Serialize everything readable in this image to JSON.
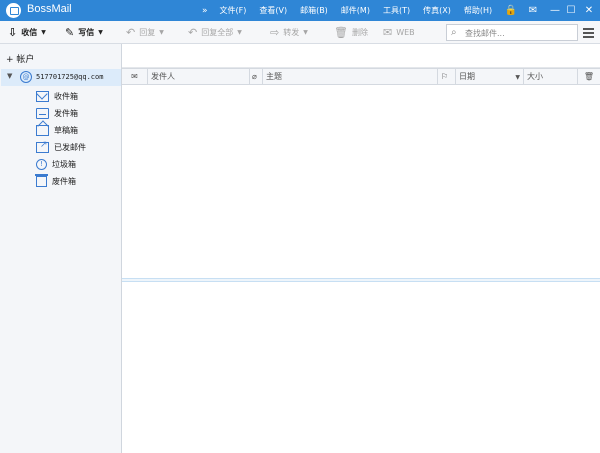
{
  "app": {
    "title": "BossMail"
  },
  "menu": [
    "文件(F)",
    "查看(V)",
    "邮箱(B)",
    "邮件(M)",
    "工具(T)",
    "传真(X)",
    "帮助(H)"
  ],
  "window": {
    "lock": "🔒",
    "minimize": "—",
    "maximize": "☐",
    "close": "✕"
  },
  "toolbar": {
    "receive": "收信",
    "compose": "写信",
    "reply": "回复",
    "reply_all": "回复全部",
    "forward": "转发",
    "delete": "删除",
    "web": "WEB",
    "search_placeholder": "查找邮件..."
  },
  "sidebar": {
    "add_account": "+ 帐户",
    "account": "517701725@qq.com",
    "folders": [
      {
        "label": "收件箱",
        "icon": "inbox-icon"
      },
      {
        "label": "发件箱",
        "icon": "outbox-icon"
      },
      {
        "label": "草稿箱",
        "icon": "drafts-icon"
      },
      {
        "label": "已发邮件",
        "icon": "sent-icon"
      },
      {
        "label": "垃圾箱",
        "icon": "junk-icon"
      },
      {
        "label": "废件箱",
        "icon": "trash-icon"
      }
    ]
  },
  "columns": {
    "sender": "发件人",
    "subject": "主题",
    "date": "日期",
    "size": "大小"
  }
}
